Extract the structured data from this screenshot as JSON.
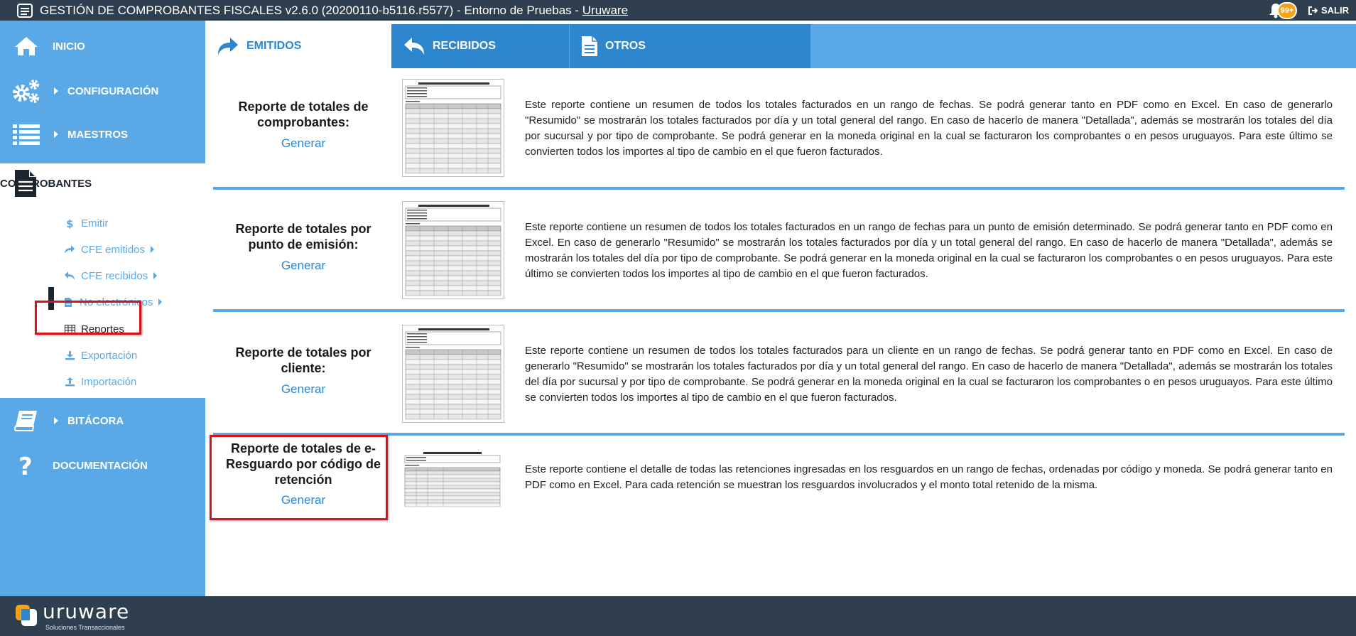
{
  "app": {
    "title": "GESTIÓN DE COMPROBANTES FISCALES v2.6.0 (20200110-b5116.r5577) - Entorno de Pruebas -",
    "title_link": "Uruware",
    "notifications_badge": "99+",
    "logout_label": "SALIR"
  },
  "sidebar": {
    "inicio": "INICIO",
    "configuracion": "CONFIGURACIÓN",
    "maestros": "MAESTROS",
    "comprobantes": "COMPROBANTES",
    "bitacora": "BITÁCORA",
    "documentacion": "DOCUMENTACIÓN",
    "sub_items": [
      {
        "label": "Emitir",
        "icon": "dollar-icon"
      },
      {
        "label": "CFE emitidos",
        "icon": "share-icon"
      },
      {
        "label": "CFE recibidos",
        "icon": "reply-icon"
      },
      {
        "label": "No electrónicos",
        "icon": "file-icon"
      },
      {
        "label": "Reportes",
        "icon": "table-icon"
      },
      {
        "label": "Exportación",
        "icon": "download-icon"
      },
      {
        "label": "Importación",
        "icon": "upload-icon"
      }
    ]
  },
  "tabs": [
    {
      "label": "EMITIDOS",
      "icon": "share-icon"
    },
    {
      "label": "RECIBIDOS",
      "icon": "reply-icon"
    },
    {
      "label": "OTROS",
      "icon": "document-icon"
    }
  ],
  "reports": [
    {
      "title": "Reporte de totales de comprobantes:",
      "action": "Generar",
      "description": "Este reporte contiene un resumen de todos los totales facturados en un rango de fechas. Se podrá generar tanto en PDF como en Excel. En caso de generarlo \"Resumido\" se mostrarán los totales facturados por día y un total general del rango. En caso de hacerlo de manera \"Detallada\", además se mostrarán los totales del día por sucursal y por tipo de comprobante. Se podrá generar en la moneda original en la cual se facturaron los comprobantes o en pesos uruguayos. Para este último se convierten todos los importes al tipo de cambio en el que fueron facturados."
    },
    {
      "title": "Reporte de totales por punto de emisión:",
      "action": "Generar",
      "description": "Este reporte contiene un resumen de todos los totales facturados en un rango de fechas para un punto de emisión determinado. Se podrá generar tanto en PDF como en Excel. En caso de generarlo \"Resumido\" se mostrarán los totales facturados por día y un total general del rango. En caso de hacerlo de manera \"Detallada\", además se mostrarán los totales del día por tipo de comprobante. Se podrá generar en la moneda original en la cual se facturaron los comprobantes o en pesos uruguayos. Para este último se convierten todos los importes al tipo de cambio en el que fueron facturados."
    },
    {
      "title": "Reporte de totales por cliente:",
      "action": "Generar",
      "description": "Este reporte contiene un resumen de todos los totales facturados para un cliente en un rango de fechas. Se podrá generar tanto en PDF como en Excel. En caso de generarlo \"Resumido\" se mostrarán los totales facturados por día y un total general del rango. En caso de hacerlo de manera \"Detallada\", además se mostrarán los totales del día por sucursal y por tipo de comprobante. Se podrá generar en la moneda original en la cual se facturaron los comprobantes o en pesos uruguayos. Para este último se convierten todos los importes al tipo de cambio en el que fueron facturados."
    },
    {
      "title": "Reporte de totales de e-Resguardo por código de retención",
      "action": "Generar",
      "description": "Este reporte contiene el detalle de todas las retenciones ingresadas en los resguardos en un rango de fechas, ordenadas por código y moneda. Se podrá generar tanto en PDF como en Excel. Para cada retención se muestran los resguardos involucrados y el monto total retenido de la misma."
    }
  ],
  "footer": {
    "brand": "uruware",
    "tagline": "Soluciones Transaccionales"
  },
  "colors": {
    "topbar": "#2f3f50",
    "sidebar": "#5aa9e6",
    "tab_dark": "#2e86cf",
    "highlight": "#d9111a",
    "badge": "#f6a11a"
  }
}
